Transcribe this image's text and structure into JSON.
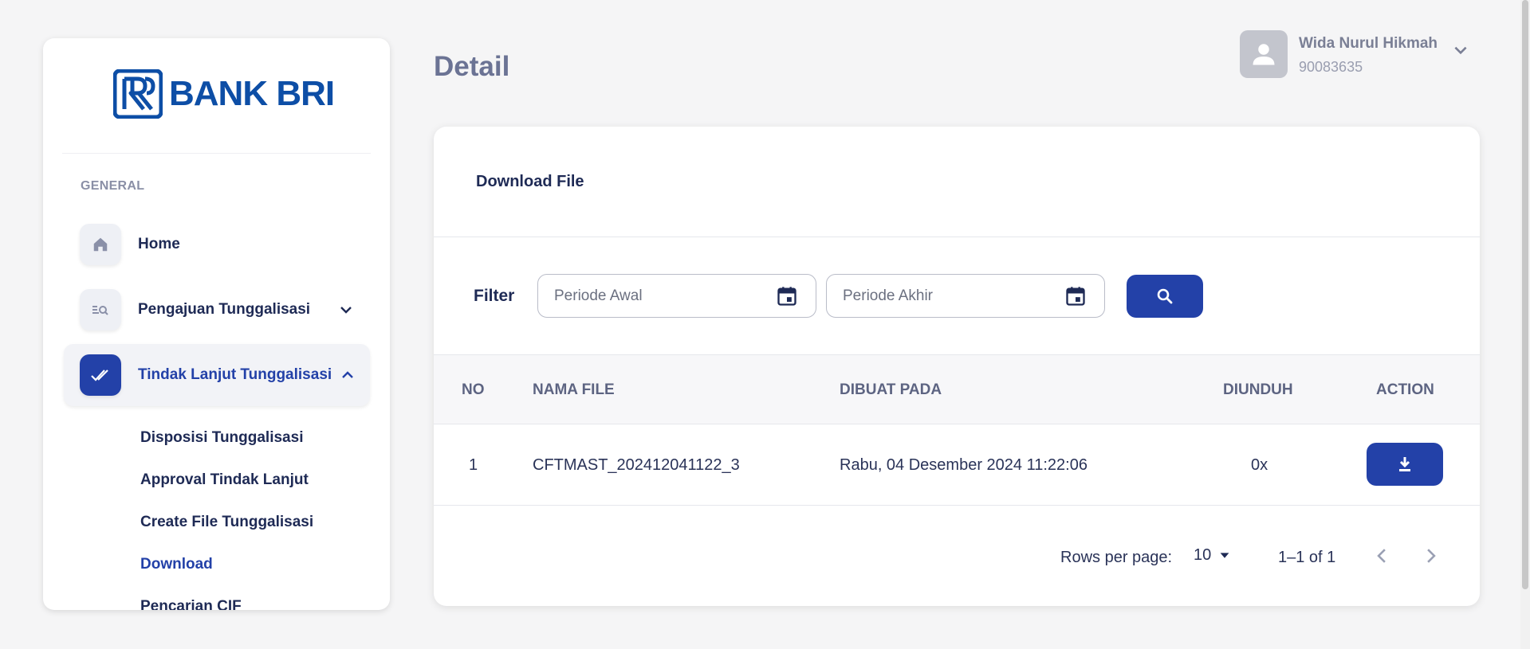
{
  "brand": {
    "logo_text": "BANK BRI",
    "color": "#0d4ea6"
  },
  "page": {
    "title": "Detail"
  },
  "user": {
    "name": "Wida Nurul Hikmah",
    "id": "90083635"
  },
  "sidebar": {
    "section_label": "GENERAL",
    "items": [
      {
        "label": "Home",
        "icon": "home-icon"
      },
      {
        "label": "Pengajuan Tunggalisasi",
        "icon": "list-search-icon"
      },
      {
        "label": "Tindak Lanjut Tunggalisasi",
        "icon": "double-check-icon"
      }
    ],
    "sub_items": [
      {
        "label": "Disposisi Tunggalisasi"
      },
      {
        "label": "Approval Tindak Lanjut"
      },
      {
        "label": "Create File Tunggalisasi"
      },
      {
        "label": "Download"
      },
      {
        "label": "Pencarian CIF"
      }
    ]
  },
  "card": {
    "title": "Download File",
    "filter": {
      "label": "Filter",
      "start_placeholder": "Periode Awal",
      "end_placeholder": "Periode Akhir"
    },
    "table": {
      "headers": {
        "no": "NO",
        "file": "NAMA FILE",
        "created": "DIBUAT PADA",
        "downloaded": "DIUNDUH",
        "action": "ACTION"
      },
      "rows": [
        {
          "no": "1",
          "file": "CFTMAST_202412041122_3",
          "created": "Rabu, 04 Desember 2024 11:22:06",
          "downloaded": "0x"
        }
      ]
    },
    "pagination": {
      "rows_per_page_label": "Rows per page:",
      "rows_per_page": "10",
      "range": "1–1 of 1"
    }
  },
  "colors": {
    "primary": "#2341a8",
    "text": "#1e2a55",
    "muted": "#6b7394"
  }
}
